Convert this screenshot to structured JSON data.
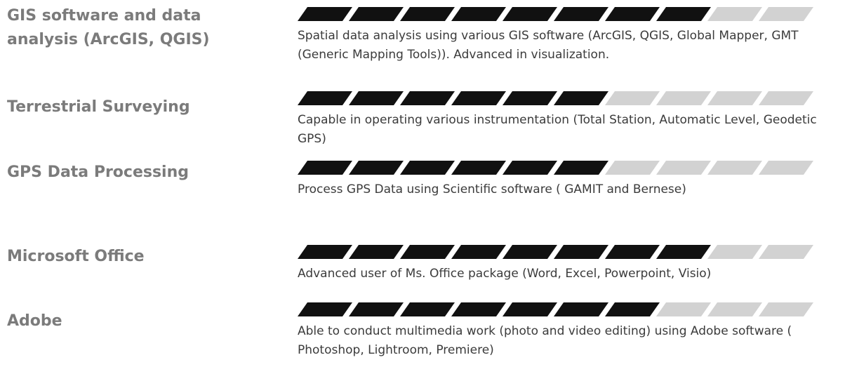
{
  "skills": [
    {
      "name": "GIS software and data analysis (ArcGIS, QGIS)",
      "level": 8,
      "max": 10,
      "description": "Spatial data analysis using various GIS software (ArcGIS, QGIS, Global Mapper, GMT (Generic Mapping Tools)). Advanced in visualization."
    },
    {
      "name": "Terrestrial Surveying",
      "level": 6,
      "max": 10,
      "description": "Capable in operating various instrumentation (Total Station, Automatic Level, Geodetic GPS)"
    },
    {
      "name": "GPS Data Processing",
      "level": 6,
      "max": 10,
      "description": "Process GPS Data using Scientific software ( GAMIT and Bernese)"
    },
    {
      "name": "Microsoft Office",
      "level": 8,
      "max": 10,
      "description": "Advanced user of Ms. Office package (Word, Excel, Powerpoint, Visio)"
    },
    {
      "name": "Adobe",
      "level": 7,
      "max": 10,
      "description": "Able to conduct multimedia work (photo and video editing) using  Adobe software ( Photoshop, Lightroom, Premiere)"
    }
  ],
  "colors": {
    "filled": "#111111",
    "empty": "#d2d2d2",
    "name": "#7b7b7b",
    "text": "#3b3b3b"
  }
}
